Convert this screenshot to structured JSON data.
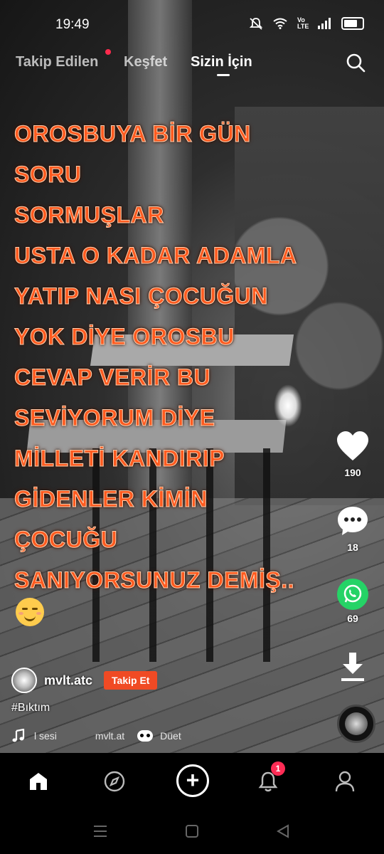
{
  "status_bar": {
    "time": "19:49",
    "network_label": "Vo LTE"
  },
  "top_tabs": {
    "following": "Takip Edilen",
    "explore": "Keşfet",
    "for_you": "Sizin İçin"
  },
  "caption": {
    "lines": [
      "OROSBUYA BİR GÜN",
      "SORU",
      "SORMUŞLAR",
      "USTA O KADAR ADAMLA",
      "YATIP NASI ÇOCUĞUN",
      "YOK DİYE OROSBU",
      "CEVAP VERİR BU",
      "SEVİYORUM DİYE",
      "MİLLETİ KANDIRIP",
      "GİDENLER KİMİN",
      "ÇOCUĞU",
      "SANIYORSUNUZ DEMİŞ.."
    ],
    "emoji_icon": "smiling-face-icon"
  },
  "actions": {
    "likes": "190",
    "comments": "18",
    "shares": "69"
  },
  "author": {
    "username": "mvlt.atc",
    "follow_label": "Takip Et"
  },
  "hashtag": "#Bıktım",
  "sound": {
    "title": "l sesi",
    "author": "mvlt.at",
    "duet_label": "Düet"
  },
  "bottom_nav": {
    "inbox_badge": "1",
    "icons": [
      "home-icon",
      "compass-icon",
      "create-icon",
      "bell-icon",
      "profile-icon"
    ]
  },
  "colors": {
    "caption_text": "#ff5a1f",
    "follow_button": "#f04a24",
    "whatsapp": "#25d366",
    "badge": "#fe2c55"
  }
}
